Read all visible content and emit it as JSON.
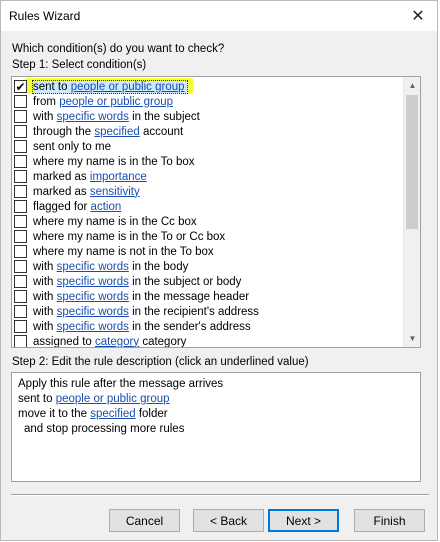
{
  "window": {
    "title": "Rules Wizard",
    "close_glyph": "✕"
  },
  "step1": {
    "question": "Which condition(s) do you want to check?",
    "label": "Step 1: Select condition(s)"
  },
  "conditions": [
    {
      "checked": true,
      "parts": [
        {
          "t": "sent to "
        },
        {
          "t": "people or public group",
          "link": true
        }
      ]
    },
    {
      "checked": false,
      "parts": [
        {
          "t": "from "
        },
        {
          "t": "people or public group",
          "link": true
        }
      ]
    },
    {
      "checked": false,
      "parts": [
        {
          "t": "with "
        },
        {
          "t": "specific words",
          "link": true
        },
        {
          "t": " in the subject"
        }
      ]
    },
    {
      "checked": false,
      "parts": [
        {
          "t": "through the "
        },
        {
          "t": "specified",
          "link": true
        },
        {
          "t": " account"
        }
      ]
    },
    {
      "checked": false,
      "parts": [
        {
          "t": "sent only to me"
        }
      ]
    },
    {
      "checked": false,
      "parts": [
        {
          "t": "where my name is in the To box"
        }
      ]
    },
    {
      "checked": false,
      "parts": [
        {
          "t": "marked as "
        },
        {
          "t": "importance",
          "link": true
        }
      ]
    },
    {
      "checked": false,
      "parts": [
        {
          "t": "marked as "
        },
        {
          "t": "sensitivity",
          "link": true
        }
      ]
    },
    {
      "checked": false,
      "parts": [
        {
          "t": "flagged for "
        },
        {
          "t": "action",
          "link": true
        }
      ]
    },
    {
      "checked": false,
      "parts": [
        {
          "t": "where my name is in the Cc box"
        }
      ]
    },
    {
      "checked": false,
      "parts": [
        {
          "t": "where my name is in the To or Cc box"
        }
      ]
    },
    {
      "checked": false,
      "parts": [
        {
          "t": "where my name is not in the To box"
        }
      ]
    },
    {
      "checked": false,
      "parts": [
        {
          "t": "with "
        },
        {
          "t": "specific words",
          "link": true
        },
        {
          "t": " in the body"
        }
      ]
    },
    {
      "checked": false,
      "parts": [
        {
          "t": "with "
        },
        {
          "t": "specific words",
          "link": true
        },
        {
          "t": " in the subject or body"
        }
      ]
    },
    {
      "checked": false,
      "parts": [
        {
          "t": "with "
        },
        {
          "t": "specific words",
          "link": true
        },
        {
          "t": " in the message header"
        }
      ]
    },
    {
      "checked": false,
      "parts": [
        {
          "t": "with "
        },
        {
          "t": "specific words",
          "link": true
        },
        {
          "t": " in the recipient's address"
        }
      ]
    },
    {
      "checked": false,
      "parts": [
        {
          "t": "with "
        },
        {
          "t": "specific words",
          "link": true
        },
        {
          "t": " in the sender's address"
        }
      ]
    },
    {
      "checked": false,
      "parts": [
        {
          "t": "assigned to "
        },
        {
          "t": "category",
          "link": true
        },
        {
          "t": " category"
        }
      ]
    }
  ],
  "step2": {
    "label": "Step 2: Edit the rule description (click an underlined value)"
  },
  "description": [
    {
      "indent": false,
      "parts": [
        {
          "t": "Apply this rule after the message arrives"
        }
      ]
    },
    {
      "indent": false,
      "parts": [
        {
          "t": "sent to "
        },
        {
          "t": "people or public group",
          "link": true
        }
      ]
    },
    {
      "indent": false,
      "parts": [
        {
          "t": "move it to the "
        },
        {
          "t": "specified",
          "link": true
        },
        {
          "t": " folder"
        }
      ]
    },
    {
      "indent": true,
      "parts": [
        {
          "t": "and stop processing more rules"
        }
      ]
    }
  ],
  "buttons": {
    "cancel": "Cancel",
    "back": "< Back",
    "next": "Next >",
    "finish": "Finish"
  },
  "icons": {
    "close": "close-icon",
    "check": "checkmark-icon",
    "scroll_up": "chevron-up-icon",
    "scroll_down": "chevron-down-icon"
  },
  "colors": {
    "link": "#1a4db3",
    "highlight": "#f6ff3b",
    "primary_border": "#0078d7"
  }
}
